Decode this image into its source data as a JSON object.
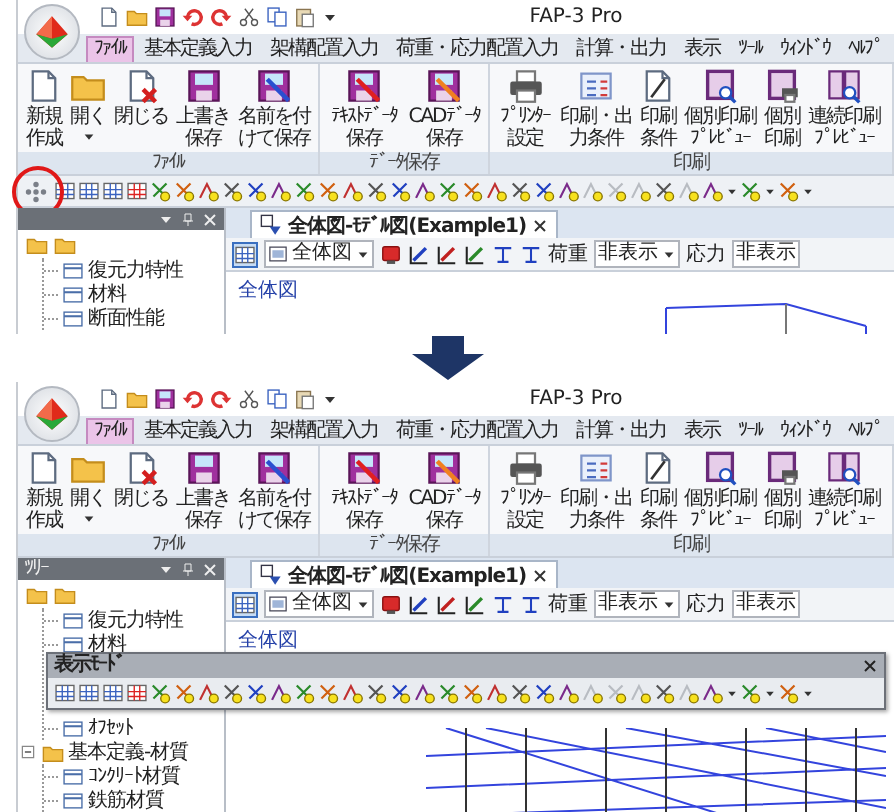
{
  "screenshots": [
    {
      "title": "FAP-3 Pro",
      "tabs": [
        {
          "label": "ﾌｧｲﾙ",
          "selected": true
        },
        {
          "label": "基本定義入力",
          "selected": false
        },
        {
          "label": "架構配置入力",
          "selected": false
        },
        {
          "label": "荷重・応力配置入力",
          "selected": false
        },
        {
          "label": "計算・出力",
          "selected": false
        },
        {
          "label": "表示",
          "selected": false
        },
        {
          "label": "ﾂｰﾙ",
          "selected": false
        },
        {
          "label": "ｳｨﾝﾄﾞｳ",
          "selected": false
        },
        {
          "label": "ﾍﾙﾌﾟ",
          "selected": false
        }
      ],
      "ribbon_groups": [
        {
          "label": "ﾌｧｲﾙ",
          "buttons": [
            {
              "label": "新規作成",
              "dropdown": false
            },
            {
              "label": "開く",
              "dropdown": true
            },
            {
              "label": "閉じる",
              "dropdown": false
            },
            {
              "label": "上書き保存",
              "dropdown": false
            },
            {
              "label": "名前を付けて保存",
              "dropdown": false
            }
          ]
        },
        {
          "label": "ﾃﾞｰﾀ保存",
          "buttons": [
            {
              "label": "ﾃｷｽﾄﾃﾞｰﾀ保存",
              "dropdown": false
            },
            {
              "label": "CADﾃﾞｰﾀ保存",
              "dropdown": false
            }
          ]
        },
        {
          "label": "印刷",
          "buttons": [
            {
              "label": "ﾌﾟﾘﾝﾀｰ設定",
              "dropdown": false
            },
            {
              "label": "印刷・出力条件",
              "dropdown": false
            },
            {
              "label": "印刷条件",
              "dropdown": false
            },
            {
              "label": "個別印刷ﾌﾟﾚﾋﾞｭｰ",
              "dropdown": false
            },
            {
              "label": "個別印刷",
              "dropdown": false
            },
            {
              "label": "連続印刷ﾌﾟﾚﾋﾞｭｰ",
              "dropdown": false
            }
          ]
        }
      ],
      "toolbar": {
        "floating": false,
        "circled": true
      },
      "tree": {
        "items": [
          {
            "kind": "continued",
            "children": [
              {
                "kind": "sheet",
                "label": "復元力特性"
              },
              {
                "kind": "sheet",
                "label": "材料"
              },
              {
                "kind": "sheet",
                "label": "断面性能"
              }
            ]
          }
        ]
      },
      "document": {
        "tab": "全体図-ﾓﾃﾞﾙ図(Example1)",
        "toggle_on": true,
        "view": "全体図",
        "load_label": "荷重",
        "load_value": "非表示",
        "stress_label": "応力",
        "stress_value": "非表示",
        "canvas_label": "全体図"
      }
    },
    {
      "title": "FAP-3 Pro",
      "tabs": [
        {
          "label": "ﾌｧｲﾙ",
          "selected": true
        },
        {
          "label": "基本定義入力",
          "selected": false
        },
        {
          "label": "架構配置入力",
          "selected": false
        },
        {
          "label": "荷重・応力配置入力",
          "selected": false
        },
        {
          "label": "計算・出力",
          "selected": false
        },
        {
          "label": "表示",
          "selected": false
        },
        {
          "label": "ﾂｰﾙ",
          "selected": false
        },
        {
          "label": "ｳｨﾝﾄﾞｳ",
          "selected": false
        },
        {
          "label": "ﾍﾙﾌﾟ",
          "selected": false
        }
      ],
      "ribbon_groups": [
        {
          "label": "ﾌｧｲﾙ",
          "buttons": [
            {
              "label": "新規作成",
              "dropdown": false
            },
            {
              "label": "開く",
              "dropdown": true
            },
            {
              "label": "閉じる",
              "dropdown": false
            },
            {
              "label": "上書き保存",
              "dropdown": false
            },
            {
              "label": "名前を付けて保存",
              "dropdown": false
            }
          ]
        },
        {
          "label": "ﾃﾞｰﾀ保存",
          "buttons": [
            {
              "label": "ﾃｷｽﾄﾃﾞｰﾀ保存",
              "dropdown": false
            },
            {
              "label": "CADﾃﾞｰﾀ保存",
              "dropdown": false
            }
          ]
        },
        {
          "label": "印刷",
          "buttons": [
            {
              "label": "ﾌﾟﾘﾝﾀｰ設定",
              "dropdown": false
            },
            {
              "label": "印刷・出力条件",
              "dropdown": false
            },
            {
              "label": "印刷条件",
              "dropdown": false
            },
            {
              "label": "個別印刷ﾌﾟﾚﾋﾞｭｰ",
              "dropdown": false
            },
            {
              "label": "個別印刷",
              "dropdown": false
            },
            {
              "label": "連続印刷ﾌﾟﾚﾋﾞｭｰ",
              "dropdown": false
            }
          ]
        }
      ],
      "toolbar": {
        "floating": true,
        "title": "表示ﾓｰﾄﾞ"
      },
      "tree": {
        "title": "ﾂﾘｰ",
        "items": [
          {
            "kind": "continued",
            "children": [
              {
                "kind": "sheet",
                "label": "復元力特性"
              },
              {
                "kind": "sheet",
                "label": "材料"
              },
              {
                "kind": "sheet",
                "label": "ｵﾌｾｯﾄ"
              }
            ]
          },
          {
            "kind": "folder",
            "label": "基本定義-材質",
            "expanded": true,
            "children": [
              {
                "kind": "sheet",
                "label": "ｺﾝｸﾘｰﾄ材質"
              },
              {
                "kind": "sheet",
                "label": "鉄筋材質"
              }
            ]
          }
        ]
      },
      "document": {
        "tab": "全体図-ﾓﾃﾞﾙ図(Example1)",
        "toggle_on": true,
        "view": "全体図",
        "load_label": "荷重",
        "load_value": "非表示",
        "stress_label": "応力",
        "stress_value": "非表示",
        "canvas_label": "全体図"
      }
    }
  ]
}
